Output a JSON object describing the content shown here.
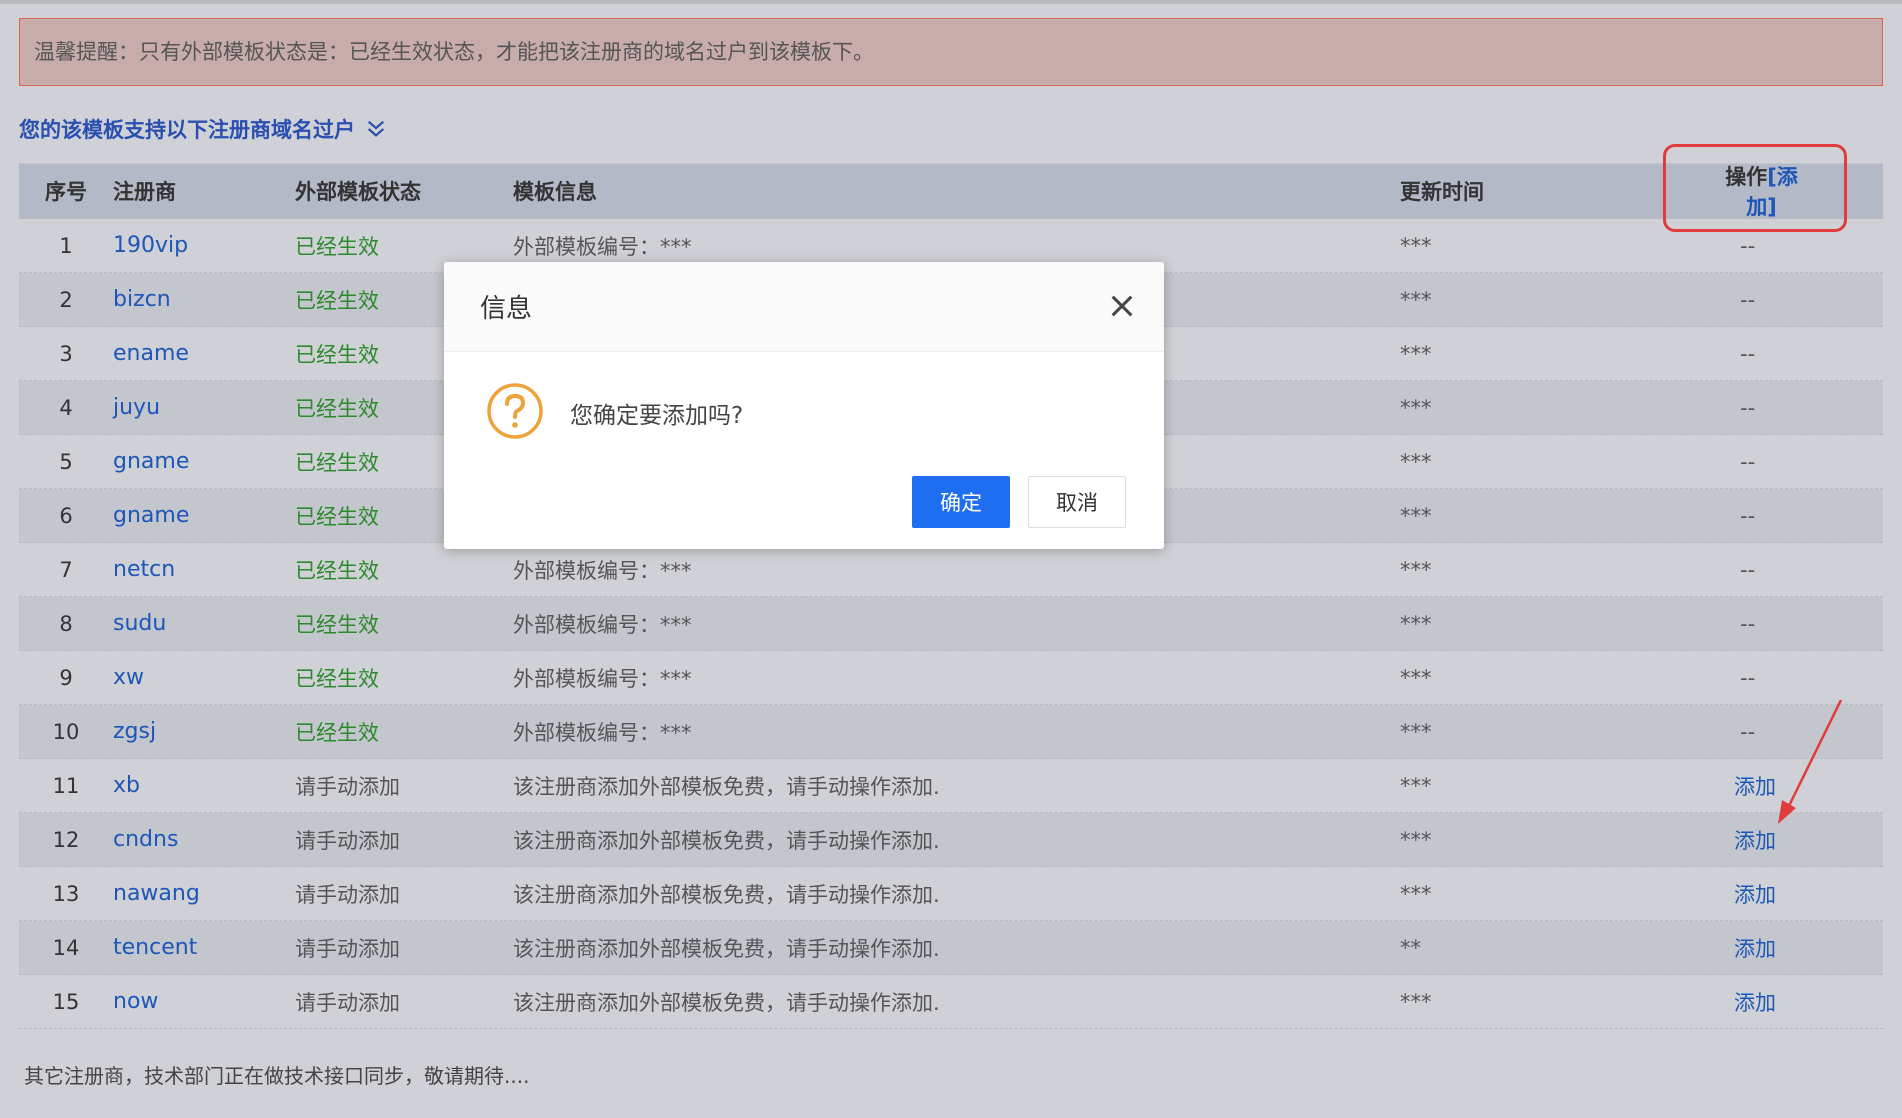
{
  "notice": "温馨提醒：只有外部模板状态是：已经生效状态，才能把该注册商的域名过户到该模板下。",
  "section_title": "您的该模板支持以下注册商域名过户",
  "table": {
    "headers": {
      "no": "序号",
      "registrar": "注册商",
      "status": "外部模板状态",
      "info": "模板信息",
      "time": "更新时间",
      "op": "操作",
      "op_add": "[添加]"
    },
    "rows": [
      {
        "no": "1",
        "registrar": "190vip",
        "status": "已经生效",
        "info": "外部模板编号：***",
        "time": "***",
        "op": "--"
      },
      {
        "no": "2",
        "registrar": "bizcn",
        "status": "已经生效",
        "info": "",
        "time": "***",
        "op": "--"
      },
      {
        "no": "3",
        "registrar": "ename",
        "status": "已经生效",
        "info": "",
        "time": "***",
        "op": "--"
      },
      {
        "no": "4",
        "registrar": "juyu",
        "status": "已经生效",
        "info": "",
        "time": "***",
        "op": "--"
      },
      {
        "no": "5",
        "registrar": "gname",
        "status": "已经生效",
        "info": "",
        "time": "***",
        "op": "--"
      },
      {
        "no": "6",
        "registrar": "gname",
        "status": "已经生效",
        "info": "",
        "time": "***",
        "op": "--"
      },
      {
        "no": "7",
        "registrar": "netcn",
        "status": "已经生效",
        "info": "外部模板编号：***",
        "time": "***",
        "op": "--"
      },
      {
        "no": "8",
        "registrar": "sudu",
        "status": "已经生效",
        "info": "外部模板编号：***",
        "time": "***",
        "op": "--"
      },
      {
        "no": "9",
        "registrar": "xw",
        "status": "已经生效",
        "info": "外部模板编号：***",
        "time": "***",
        "op": "--"
      },
      {
        "no": "10",
        "registrar": "zgsj",
        "status": "已经生效",
        "info": "外部模板编号：***",
        "time": "***",
        "op": "--"
      },
      {
        "no": "11",
        "registrar": "xb",
        "status": "请手动添加",
        "info": "该注册商添加外部模板免费，请手动操作添加.",
        "time": "***",
        "op": "添加"
      },
      {
        "no": "12",
        "registrar": "cndns",
        "status": "请手动添加",
        "info": "该注册商添加外部模板免费，请手动操作添加.",
        "time": "***",
        "op": "添加"
      },
      {
        "no": "13",
        "registrar": "nawang",
        "status": "请手动添加",
        "info": "该注册商添加外部模板免费，请手动操作添加.",
        "time": "***",
        "op": "添加"
      },
      {
        "no": "14",
        "registrar": "tencent",
        "status": "请手动添加",
        "info": "该注册商添加外部模板免费，请手动操作添加.",
        "time": "**",
        "op": "添加"
      },
      {
        "no": "15",
        "registrar": "now",
        "status": "请手动添加",
        "info": "该注册商添加外部模板免费，请手动操作添加.",
        "time": "***",
        "op": "添加"
      }
    ]
  },
  "footer_note": "其它注册商，技术部门正在做技术接口同步，敬请期待....",
  "dialog": {
    "title": "信息",
    "message": "您确定要添加吗?",
    "ok_label": "确定",
    "cancel_label": "取消"
  },
  "colors": {
    "accent": "#1f6ef0",
    "link": "#1e56b8",
    "active_status": "#2c8a2c",
    "annotation_red": "#e23b3b",
    "question_icon": "#f0a23a"
  },
  "icons": [
    "chevron-double-down-icon",
    "close-icon",
    "question-icon"
  ]
}
